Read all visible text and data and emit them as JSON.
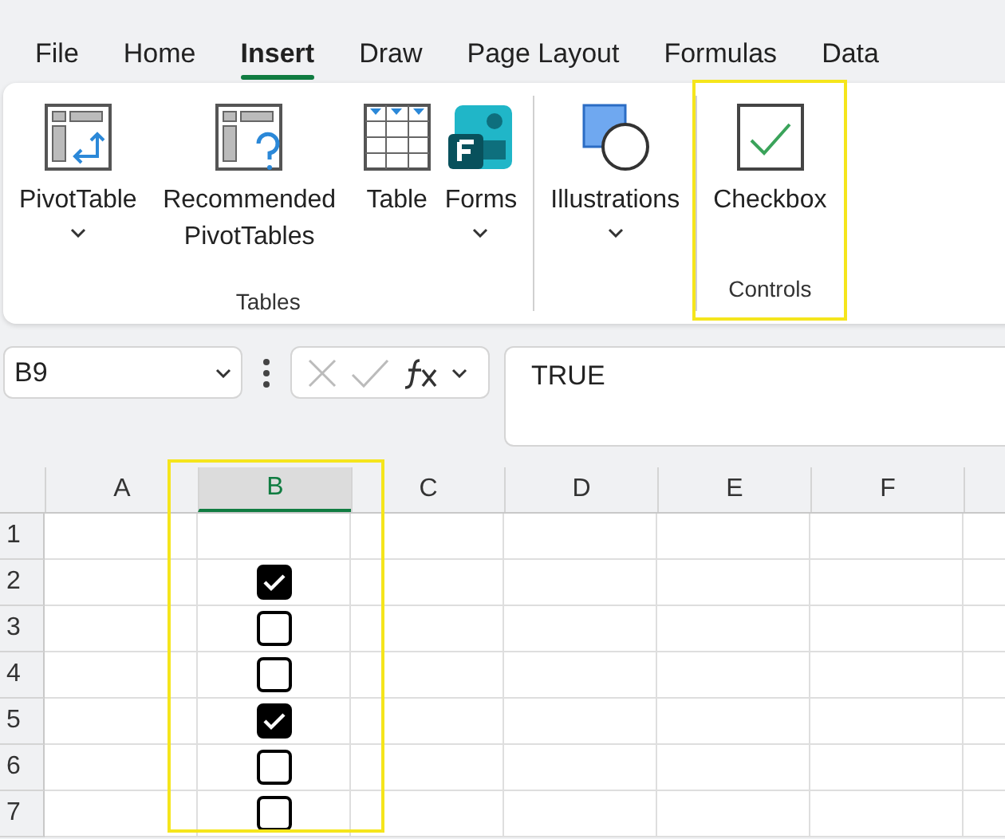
{
  "menu_tabs": [
    {
      "label": "File",
      "selected": false
    },
    {
      "label": "Home",
      "selected": false
    },
    {
      "label": "Insert",
      "selected": true
    },
    {
      "label": "Draw",
      "selected": false
    },
    {
      "label": "Page Layout",
      "selected": false
    },
    {
      "label": "Formulas",
      "selected": false
    },
    {
      "label": "Data",
      "selected": false
    }
  ],
  "ribbon": {
    "groups": [
      {
        "label": "Tables",
        "buttons": [
          {
            "kind": "pivot",
            "label": "PivotTable",
            "dropdown": true
          },
          {
            "kind": "recommended",
            "label": "Recommended PivotTables"
          },
          {
            "kind": "table",
            "label": "Table"
          },
          {
            "kind": "forms",
            "label": "Forms",
            "dropdown": true
          }
        ]
      },
      {
        "buttons": [
          {
            "kind": "illustrations",
            "label": "Illustrations",
            "dropdown": true
          }
        ]
      },
      {
        "label": "Controls",
        "highlighted": true,
        "buttons": [
          {
            "kind": "checkbox",
            "label": "Checkbox"
          }
        ]
      }
    ]
  },
  "formula_bar": {
    "name_box": "B9",
    "formula": "TRUE"
  },
  "sheet": {
    "columns": [
      {
        "label": "A",
        "selected": false
      },
      {
        "label": "B",
        "selected": true,
        "highlighted": true
      },
      {
        "label": "C",
        "selected": false
      },
      {
        "label": "D",
        "selected": false
      },
      {
        "label": "E",
        "selected": false
      },
      {
        "label": "F",
        "selected": false
      }
    ],
    "rows": [
      {
        "label": "1",
        "cells": [
          {
            "kind": "empty"
          },
          {
            "kind": "empty"
          }
        ]
      },
      {
        "label": "2",
        "cells": [
          {
            "kind": "empty"
          },
          {
            "kind": "checkbox",
            "checked": true
          }
        ]
      },
      {
        "label": "3",
        "cells": [
          {
            "kind": "empty"
          },
          {
            "kind": "checkbox",
            "checked": false
          }
        ]
      },
      {
        "label": "4",
        "cells": [
          {
            "kind": "empty"
          },
          {
            "kind": "checkbox",
            "checked": false
          }
        ]
      },
      {
        "label": "5",
        "cells": [
          {
            "kind": "empty"
          },
          {
            "kind": "checkbox",
            "checked": true
          }
        ]
      },
      {
        "label": "6",
        "cells": [
          {
            "kind": "empty"
          },
          {
            "kind": "checkbox",
            "checked": false
          }
        ]
      },
      {
        "label": "7",
        "cells": [
          {
            "kind": "empty"
          },
          {
            "kind": "checkbox",
            "checked": false
          }
        ]
      }
    ]
  }
}
